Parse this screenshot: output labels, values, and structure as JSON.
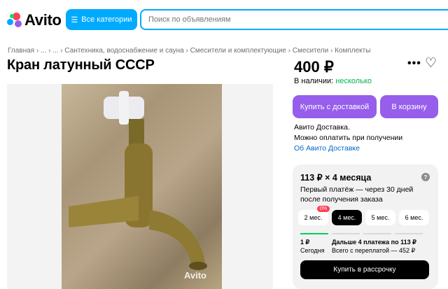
{
  "header": {
    "logo_text": "Avito",
    "categories_label": "Все категории",
    "search_placeholder": "Поиск по объявлениям"
  },
  "breadcrumbs": [
    "Главная",
    "...",
    "...",
    "Сантехника, водоснабжение и сауна",
    "Смесители и комплектующие",
    "Смесители",
    "Комплекты"
  ],
  "listing": {
    "title": "Кран латунный СССР",
    "price": "400 ₽",
    "stock_label": "В наличии:",
    "stock_value": "несколько",
    "buy_delivery_label": "Купить с доставкой",
    "cart_label": "В корзину",
    "delivery_line1": "Авито Доставка.",
    "delivery_line2": "Можно оплатить при получении",
    "delivery_link": "Об Авито Доставке",
    "photo_watermark": "Avito"
  },
  "installment": {
    "title": "113 ₽ × 4 месяца",
    "subtitle": "Первый платёж — через 30 дней после получения заказа",
    "terms": [
      "2 мес.",
      "4 мес.",
      "5 мес.",
      "6 мес."
    ],
    "selected_term": "4 мес.",
    "badge": "0%",
    "first_amount": "1 ₽",
    "first_when": "Сегодня",
    "next_payments": "Дальше 4 платежа по 113 ₽",
    "total_overpay": "Всего с переплатой — 452 ₽",
    "button_label": "Купить в рассрочку"
  },
  "colors": {
    "accent_blue": "#00aaff",
    "purple": "#965eeb",
    "green": "#02b34f",
    "link": "#0068c8"
  }
}
